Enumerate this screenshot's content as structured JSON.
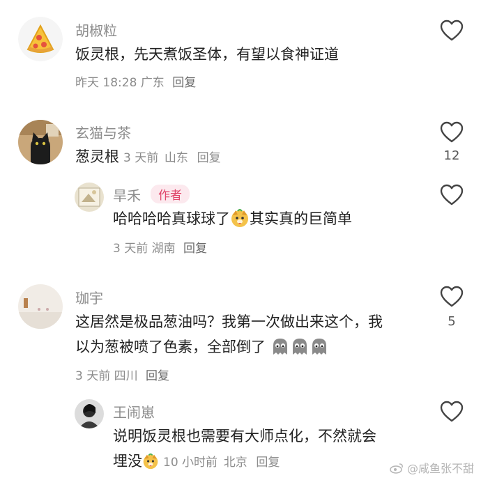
{
  "comments": [
    {
      "name": "胡椒粒",
      "text": "饭灵根，先天煮饭圣体，有望以食神证道",
      "time": "昨天 18:28",
      "location": "广东",
      "reply_label": "回复",
      "like_count": ""
    },
    {
      "name": "玄猫与茶",
      "text": "葱灵根",
      "time": "3 天前",
      "location": "山东",
      "reply_label": "回复",
      "like_count": "12"
    },
    {
      "name": "旱禾",
      "badge": "作者",
      "text_before": "哈哈哈哈真球球了",
      "text_after": "其实真的巨简单",
      "time": "3 天前",
      "location": "湖南",
      "reply_label": "回复",
      "like_count": ""
    },
    {
      "name": "珈宇",
      "text_line1": "这居然是极品葱油吗？我第一次做出来这个，我",
      "text_line2": "以为葱被喷了色素，全部倒了",
      "time": "3 天前",
      "location": "四川",
      "reply_label": "回复",
      "like_count": "5"
    },
    {
      "name": "王闹崽",
      "text_line1": "说明饭灵根也需要有大师点化，不然就会",
      "text_line2": "埋没",
      "time": "10 小时前",
      "location": "北京",
      "reply_label": "回复",
      "like_count": ""
    }
  ],
  "watermark": "@咸鱼张不甜",
  "colors": {
    "name": "#8c8c8c",
    "text": "#222222",
    "author_badge": "#e0456a",
    "author_badge_bg": "#fce9ee"
  },
  "icons": [
    "pizza-avatar",
    "black-cat-avatar",
    "heart-outline-icon",
    "dog-emoji",
    "ghost-emoji",
    "weibo-logo"
  ]
}
